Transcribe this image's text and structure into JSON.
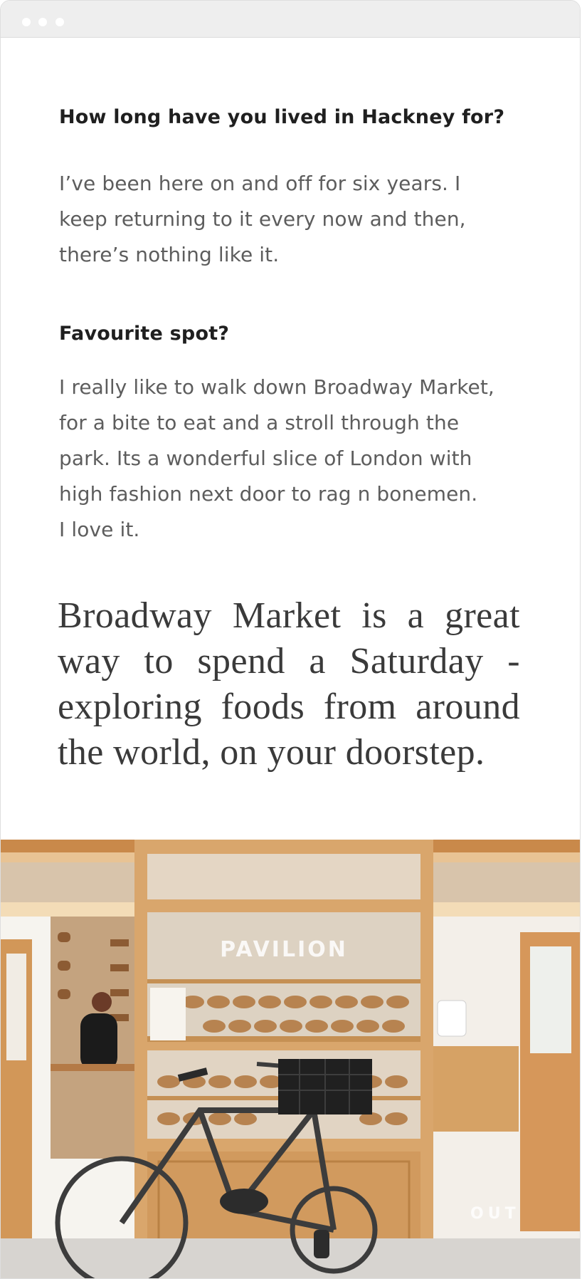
{
  "article": {
    "question_1": "How long have you lived in Hackney for?",
    "answer_1": "I’ve been here on and off for six years.  I\nkeep returning to it every now and then,\nthere’s nothing like it.",
    "question_2": "Favourite spot?",
    "answer_2": "I really like to walk down Broadway Market,\nfor a bite to eat and a stroll through the\npark. Its a wonderful slice of London with\nhigh fashion next door to rag n bonemen.\nI love it.",
    "pull_quote": "Broadway Market is a great way to spend a Saturday - exploring foods from around the world, on your doorstep."
  },
  "photo": {
    "shop_sign": "PAVILION",
    "floor_marking": "OUT"
  },
  "colors": {
    "question_text": "#1f1f1f",
    "answer_text": "#5d5d5d",
    "pull_quote_text": "#3a3a3a",
    "titlebar": "#eeeeee",
    "window_dot": "#ffffff",
    "wood": "#d9a66c"
  }
}
